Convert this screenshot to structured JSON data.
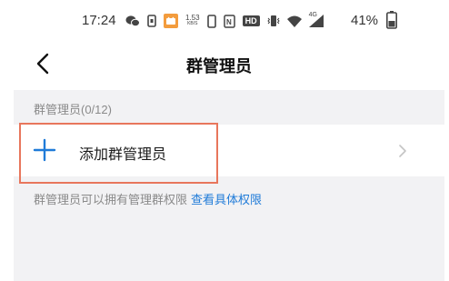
{
  "status_bar": {
    "time": "17:24",
    "net_speed_value": "1.53",
    "net_speed_unit": "KB/S",
    "hd_label": "HD",
    "signal_label": "4G",
    "battery": "41%"
  },
  "nav": {
    "title": "群管理员"
  },
  "section": {
    "header": "群管理员(0/12)"
  },
  "add_admin": {
    "label": "添加群管理员"
  },
  "hint": {
    "text": "群管理员可以拥有管理群权限",
    "link": "查看具体权限"
  },
  "colors": {
    "accent_blue": "#1f7bd8",
    "highlight": "#e8765c",
    "background": "#f2f2f4"
  }
}
